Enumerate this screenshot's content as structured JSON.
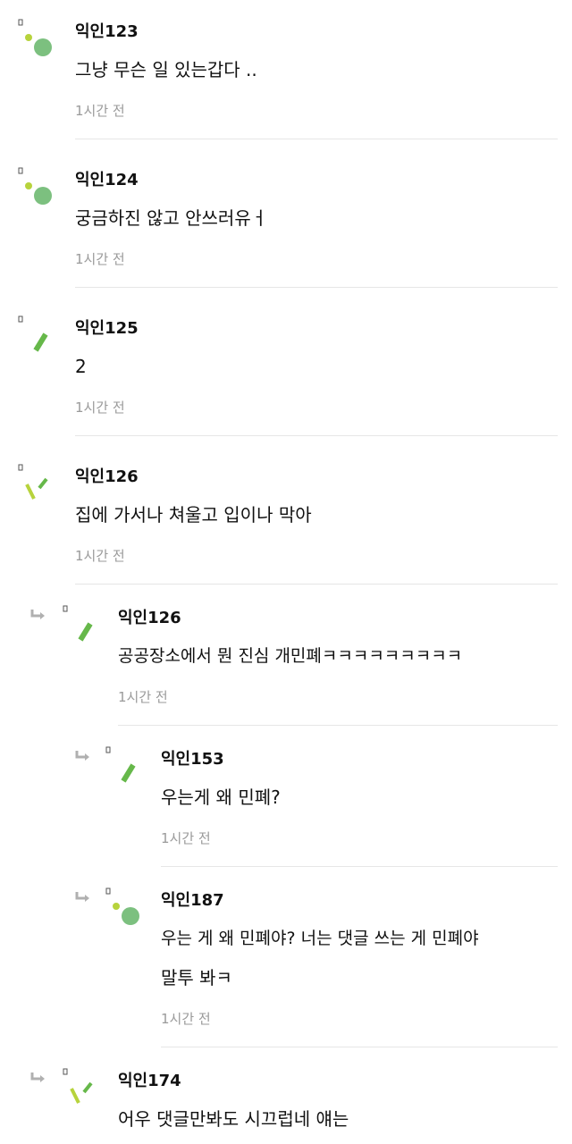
{
  "comments": [
    {
      "author": "익인123",
      "text": "그냥 무슨 일 있는갑다 ..",
      "time": "1시간 전",
      "icon": "dots-circle-icon",
      "depth": 0
    },
    {
      "author": "익인124",
      "text": "궁금하진 않고 안쓰러유ㅓ",
      "time": "1시간 전",
      "icon": "dots-circle-icon",
      "depth": 0
    },
    {
      "author": "익인125",
      "text": "2",
      "time": "1시간 전",
      "icon": "slash-bar-icon",
      "depth": 0
    },
    {
      "author": "익인126",
      "text": "집에 가서나 쳐울고 입이나 막아",
      "time": "1시간 전",
      "icon": "v-lines-icon",
      "depth": 0
    },
    {
      "author": "익인126",
      "text": "공공장소에서 뭔 진심 개민폐ㅋㅋㅋㅋㅋㅋㅋㅋㅋ",
      "time": "1시간 전",
      "icon": "slash-bar-icon",
      "depth": 1
    },
    {
      "author": "익인153",
      "text": "우는게 왜 민폐?",
      "time": "1시간 전",
      "icon": "slash-bar-icon",
      "depth": 2
    },
    {
      "author": "익인187",
      "text_line1": "우는 게 왜 민폐야? 너는 댓글 쓰는 게 민폐야",
      "text_line2": "말투 봐ㅋ",
      "time": "1시간 전",
      "icon": "dots-circle-icon",
      "depth": 2
    },
    {
      "author": "익인174",
      "text": "어우 댓글만봐도 시끄럽네 얘는",
      "icon": "v-lines-icon",
      "depth": 1
    }
  ],
  "colors": {
    "green": "#7cc07f",
    "lime": "#b7d33c",
    "grass": "#66b84a",
    "time_gray": "#9a9a9a",
    "divider": "#e6e6e6"
  }
}
